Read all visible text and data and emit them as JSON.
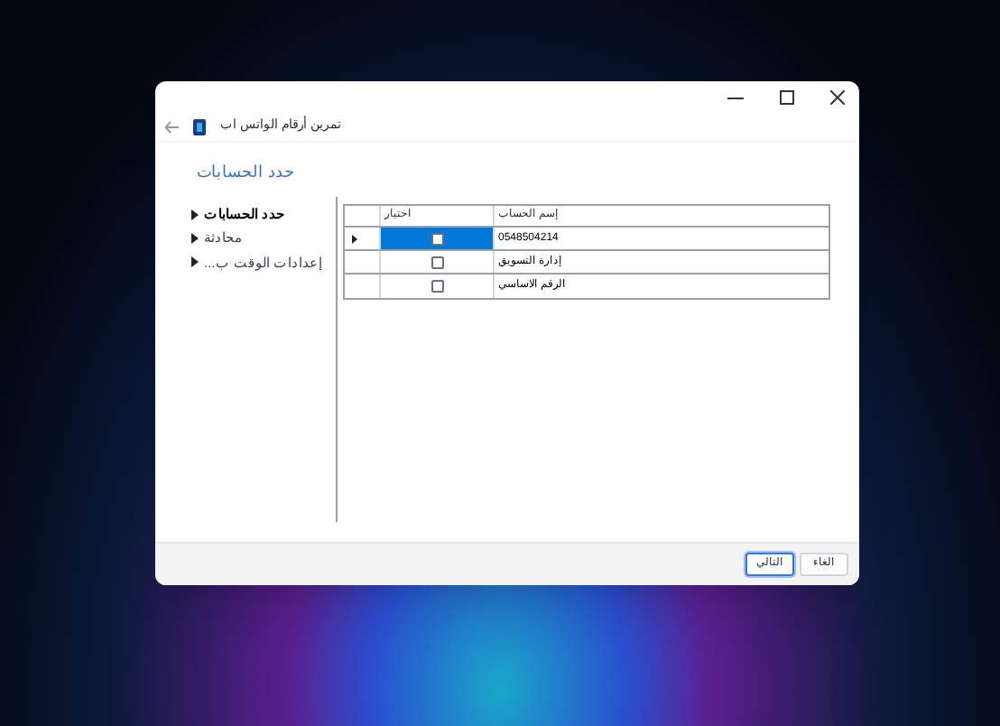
{
  "window": {
    "title": "تمرين أرقام الواتس اب"
  },
  "page_heading": "حدد الحسابات",
  "nav": {
    "items": [
      {
        "label": "حدد الحسابات",
        "selected": true
      },
      {
        "label": "محادثة",
        "selected": false
      },
      {
        "label": "إعدادات الوقت ب...",
        "selected": false
      }
    ]
  },
  "grid": {
    "columns": [
      "إسم الحساب",
      "اختيار"
    ],
    "rows": [
      {
        "checked": false,
        "name": "0548504214",
        "current": true,
        "selected": true
      },
      {
        "checked": false,
        "name": "إدارة التسويق",
        "current": false,
        "selected": false
      },
      {
        "checked": false,
        "name": "الرقم الاساسي",
        "current": false,
        "selected": false
      }
    ]
  },
  "buttons": [
    {
      "label": "الغاء",
      "focused": false
    },
    {
      "label": "التالي",
      "focused": true
    }
  ]
}
